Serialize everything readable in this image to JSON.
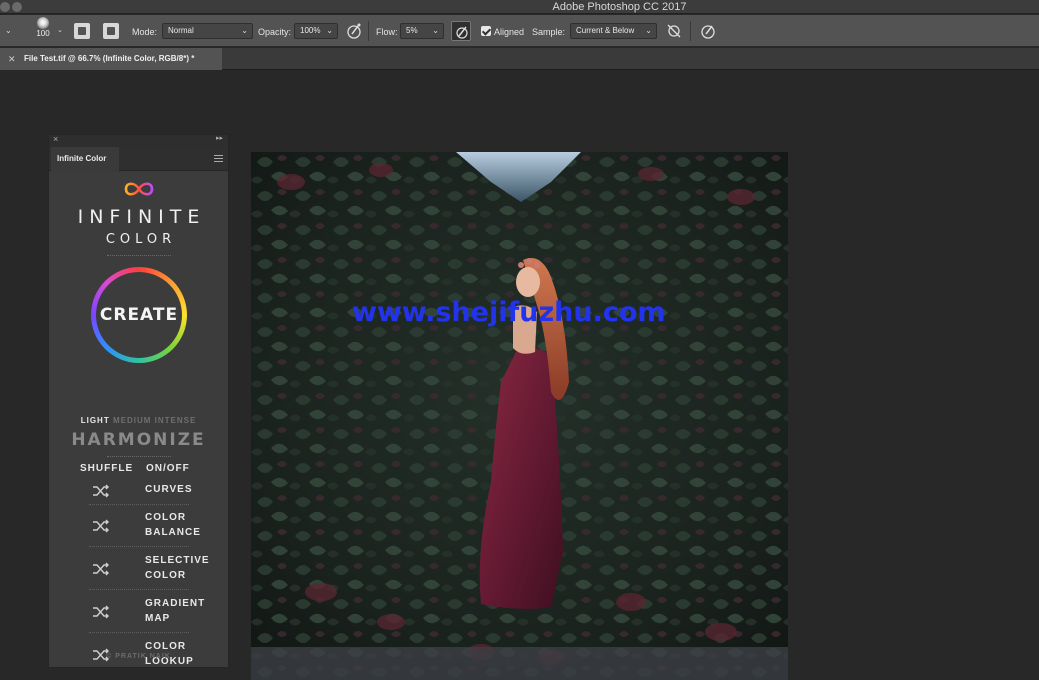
{
  "window": {
    "title": "Adobe Photoshop CC 2017"
  },
  "options_bar": {
    "brush_size": "100",
    "mode_label": "Mode:",
    "mode_value": "Normal",
    "opacity_label": "Opacity:",
    "opacity_value": "100%",
    "flow_label": "Flow:",
    "flow_value": "5%",
    "aligned_label": "Aligned",
    "aligned_checked": true,
    "sample_label": "Sample:",
    "sample_value": "Current & Below"
  },
  "document_tab": {
    "title": "File Test.tif @ 66.7% (Infinite Color, RGB/8*) *"
  },
  "panel": {
    "tab_label": "Infinite Color",
    "brand_line1": "INFINITE",
    "brand_line2": "COLOR",
    "create_label": "CREATE",
    "intensity": {
      "light": "LIGHT",
      "medium": "MEDIUM",
      "intense": "INTENSE",
      "selected": "LIGHT"
    },
    "harmonize_label": "HARMONIZE",
    "shuffle_header": "SHUFFLE",
    "onoff_header": "ON/OFF",
    "adjustments": [
      {
        "line1": "CURVES",
        "line2": ""
      },
      {
        "line1": "COLOR",
        "line2": "BALANCE"
      },
      {
        "line1": "SELECTIVE",
        "line2": "COLOR"
      },
      {
        "line1": "GRADIENT",
        "line2": "MAP"
      },
      {
        "line1": "COLOR",
        "line2": "LOOKUP"
      }
    ],
    "footer": "© PRATIK NAIK"
  },
  "watermark": "www.shejifuzhu.com",
  "colors": {
    "app_bg": "#282828",
    "options_bar": "#535353",
    "panel_bg": "#3c3c3c",
    "watermark": "#2233ee"
  }
}
